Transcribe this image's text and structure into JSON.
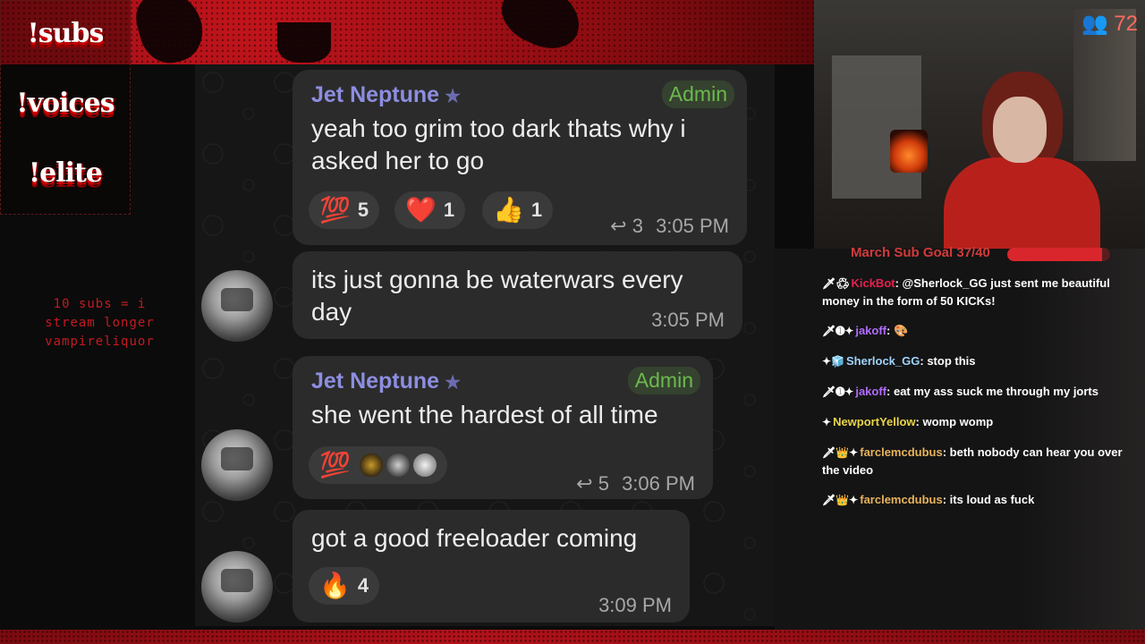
{
  "overlay": {
    "commands": [
      "!subs",
      "!voices",
      "!elite"
    ],
    "promo_lines": [
      "10 subs = i",
      "stream longer",
      "vampireliquor"
    ],
    "viewer_count": "72"
  },
  "colors": {
    "accent_red": "#c0141c",
    "admin_green": "#6cb94f",
    "sender_purple": "#8d8ee0"
  },
  "telegram": {
    "messages": [
      {
        "sender": "Jet Neptune",
        "role": "Admin",
        "text_line1": "yeah too grim too dark thats why i",
        "text_line2": "asked her to go",
        "reactions": [
          {
            "emoji": "💯",
            "count": "5"
          },
          {
            "emoji": "❤️",
            "count": "1"
          },
          {
            "emoji": "👍",
            "count": "1"
          }
        ],
        "replies": "3",
        "time": "3:05 PM"
      },
      {
        "text_line1": "its just gonna be waterwars every",
        "text_line2": "day",
        "time": "3:05 PM"
      },
      {
        "sender": "Jet Neptune",
        "role": "Admin",
        "text_line1": "she went the hardest of all time",
        "reactions": [
          {
            "emoji": "💯"
          }
        ],
        "replies": "5",
        "time": "3:06 PM"
      },
      {
        "text_line1": "got a good freeloader coming",
        "reactions": [
          {
            "emoji": "🔥",
            "count": "4"
          }
        ],
        "time": "3:09 PM"
      }
    ]
  },
  "sub_goal": {
    "label": "March Sub Goal 37/40",
    "current": 37,
    "target": 40
  },
  "kick_chat": [
    {
      "user": "KickBot",
      "user_color": "#e5214f",
      "badges": "🗡♻",
      "text": "@Sherlock_GG just sent me beautiful money in the form of 50 KICKs!"
    },
    {
      "user": "jakoff",
      "user_color": "#b26bff",
      "badges": "🗡➊✦",
      "text": "🎨"
    },
    {
      "user": "Sherlock_GG",
      "user_color": "#9fd4ff",
      "badges": "✦🧊",
      "text": "stop this"
    },
    {
      "user": "jakoff",
      "user_color": "#b26bff",
      "badges": "🗡➊✦",
      "text": "eat my ass suck me through my jorts"
    },
    {
      "user": "NewportYellow",
      "user_color": "#e9d44a",
      "badges": "✦",
      "text": "womp womp"
    },
    {
      "user": "farclemcdubus",
      "user_color": "#e8b35b",
      "badges": "🗡👑✦",
      "text": "beth nobody can hear you over the video"
    },
    {
      "user": "farclemcdubus",
      "user_color": "#e8b35b",
      "badges": "🗡👑✦",
      "text": "its loud as fuck"
    }
  ]
}
